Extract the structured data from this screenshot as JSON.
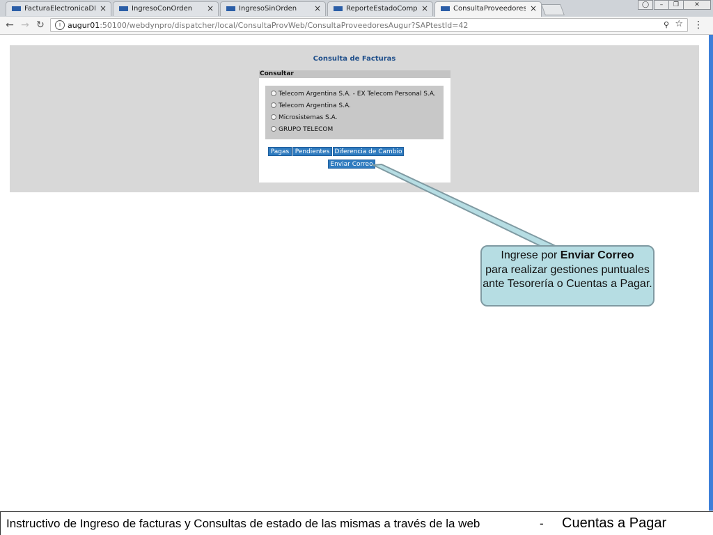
{
  "browser": {
    "tabs": [
      {
        "title": "FacturaElectronicaDES_C",
        "active": false
      },
      {
        "title": "IngresoConOrden",
        "active": false
      },
      {
        "title": "IngresoSinOrden",
        "active": false
      },
      {
        "title": "ReporteEstadoComproba",
        "active": false
      },
      {
        "title": "ConsultaProveedoresAug",
        "active": true
      }
    ],
    "url_host": "augur01",
    "url_rest": ":50100/webdynpro/dispatcher/local/ConsultaProvWeb/ConsultaProveedoresAugur?SAPtestId=42"
  },
  "page": {
    "title": "Consulta de Facturas",
    "section_label": "Consultar",
    "options": [
      "Telecom Argentina S.A. -  EX Telecom Personal S.A.",
      "Telecom Argentina S.A.",
      "Microsistemas S.A.",
      "GRUPO TELECOM"
    ],
    "buttons": {
      "pagas": "Pagas",
      "pendientes": "Pendientes",
      "diferencia": "Diferencia de Cambio",
      "enviar": "Enviar Correo"
    }
  },
  "callout": {
    "prefix": "Ingrese por ",
    "bold": "Enviar Correo",
    "rest": "para realizar gestiones puntuales ante Tesorería o Cuentas a Pagar."
  },
  "footer": {
    "text": "Instructivo de Ingreso de facturas y Consultas de estado de las mismas a través de la web",
    "dash": "-",
    "right": "Cuentas a Pagar"
  },
  "colors": {
    "sap_button": "#2f7bbf",
    "page_title": "#1e4e8a",
    "callout_fill": "#b6dde3"
  }
}
